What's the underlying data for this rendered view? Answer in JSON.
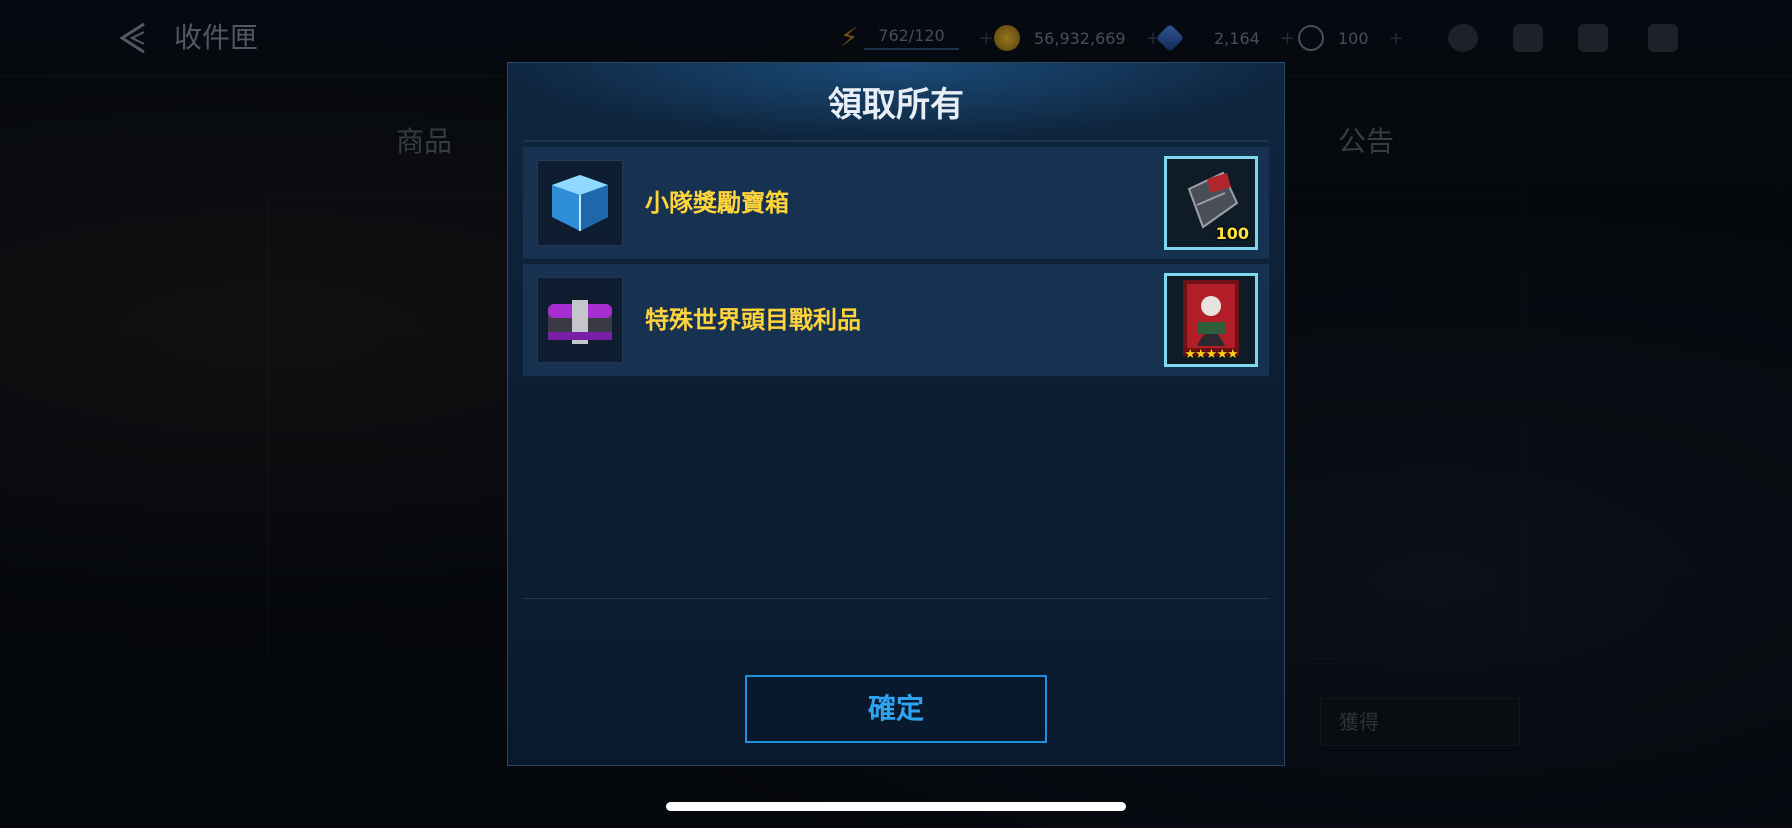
{
  "header": {
    "title": "收件匣",
    "resources": [
      {
        "name": "energy",
        "value": "762/120",
        "color": "#d89b2a"
      },
      {
        "name": "gold",
        "value": "56,932,669",
        "color": "#c9a21d"
      },
      {
        "name": "crystal",
        "value": "2,164",
        "color": "#3a6fd0"
      },
      {
        "name": "stamina",
        "value": "100",
        "color": "#8a96a4"
      }
    ]
  },
  "tabs": [
    "商品",
    "公告"
  ],
  "filter": {
    "selected": "獲得"
  },
  "modal": {
    "title": "領取所有",
    "items": [
      {
        "label": "小隊獎勵寶箱",
        "icon": "blue-cube-chest-icon",
        "reward_icon": "uniform-ticket-icon",
        "reward_count": "100"
      },
      {
        "label": "特殊世界頭目戰利品",
        "icon": "purple-chest-icon",
        "reward_icon": "hero-card-icon",
        "reward_stars": "★★★★★"
      }
    ],
    "confirm_label": "確定"
  }
}
